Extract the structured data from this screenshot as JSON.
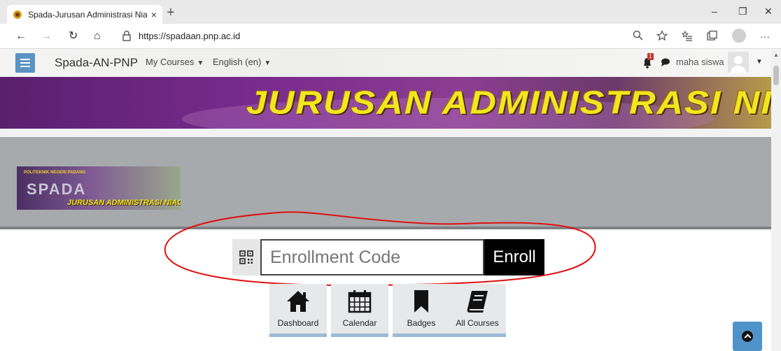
{
  "browser": {
    "tab_title": "Spada-Jurusan Administrasi Niag",
    "tab_close": "×",
    "new_tab": "+",
    "url": "https://spadaan.pnp.ac.id",
    "back": "←",
    "forward": "→",
    "refresh": "↻",
    "home": "⌂",
    "window_minimize": "–",
    "window_maximize": "❐",
    "window_close": "✕",
    "more": "···"
  },
  "site_nav": {
    "brand": "Spada-AN-PNP",
    "links": [
      {
        "label": "My Courses",
        "caret": "▼"
      },
      {
        "label": "English (en)",
        "caret": "▼"
      }
    ],
    "notifications_count": "1",
    "username": "maha siswa",
    "user_caret": "▼"
  },
  "banner": {
    "title": "JURUSAN ADMINISTRASI NIAGA"
  },
  "logo": {
    "small_text": "POLITEKNIK NEGERI PADANG",
    "spada": "SPADA",
    "jurusan": "JURUSAN ADMINISTRASI NIAGA"
  },
  "enroll": {
    "placeholder": "Enrollment Code",
    "button": "Enroll"
  },
  "tiles": [
    {
      "label": "Dashboard",
      "icon": "home-icon"
    },
    {
      "label": "Calendar",
      "icon": "calendar-icon"
    },
    {
      "label": "Badges",
      "icon": "bookmark-icon"
    },
    {
      "label": "All Courses",
      "icon": "book-icon"
    }
  ],
  "colors": {
    "accent": "#5a93c4",
    "tile_border": "#9bbbd7",
    "banner_text": "#f2e61f",
    "annotation": "#e01010"
  }
}
